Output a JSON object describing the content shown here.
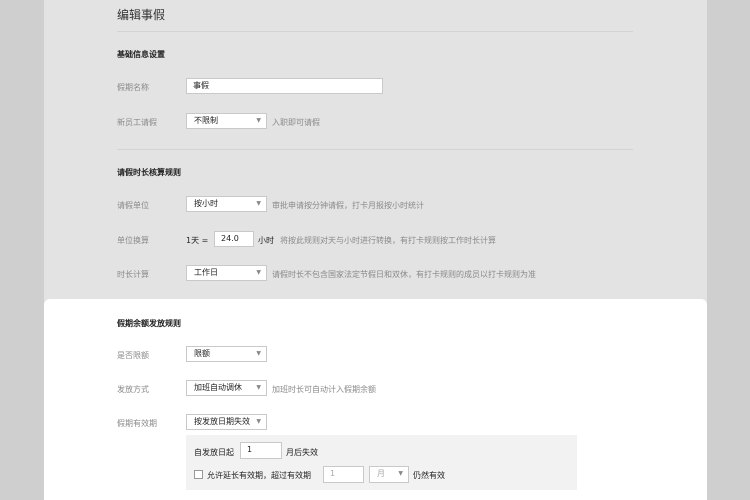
{
  "page_title": "编辑事假",
  "sections": {
    "basic": "基础信息设置",
    "duration_rules": "请假时长核算规则",
    "balance_rules": "假期余额发放规则"
  },
  "fields": {
    "leave_name": {
      "label": "假期名称",
      "value": "事假"
    },
    "new_employee": {
      "label": "新员工请假",
      "value": "不限制",
      "hint": "入职即可请假"
    },
    "leave_unit": {
      "label": "请假单位",
      "value": "按小时",
      "hint": "审批申请按分钟请假，打卡月报按小时统计"
    },
    "unit_conversion": {
      "label": "单位换算",
      "prefix": "1天 =",
      "value": "24.0",
      "unit": "小时",
      "hint": "将按此规则对天与小时进行转换，有打卡规则按工作时长计算"
    },
    "duration_calc": {
      "label": "时长计算",
      "value": "工作日",
      "hint": "请假时长不包含国家法定节假日和双休，有打卡规则的成员以打卡规则为准"
    },
    "is_limited": {
      "label": "是否限额",
      "value": "限额"
    },
    "grant_method": {
      "label": "发放方式",
      "value": "加班自动调休",
      "hint": "加班时长可自动计入假期余额"
    },
    "validity": {
      "label": "假期有效期",
      "value": "按发放日期失效"
    }
  },
  "validity_box": {
    "from_label": "自发放日起",
    "months_value": "1",
    "months_suffix": "月后失效",
    "extend_label": "允许延长有效期，超过有效期",
    "extend_value_placeholder": "1",
    "extend_unit": "月",
    "extend_suffix": "仍然有效"
  },
  "colors": {
    "page_bg": "#cfcfcf",
    "panel_bg": "#e3e3e3",
    "highlight_bg": "#ffffff"
  }
}
